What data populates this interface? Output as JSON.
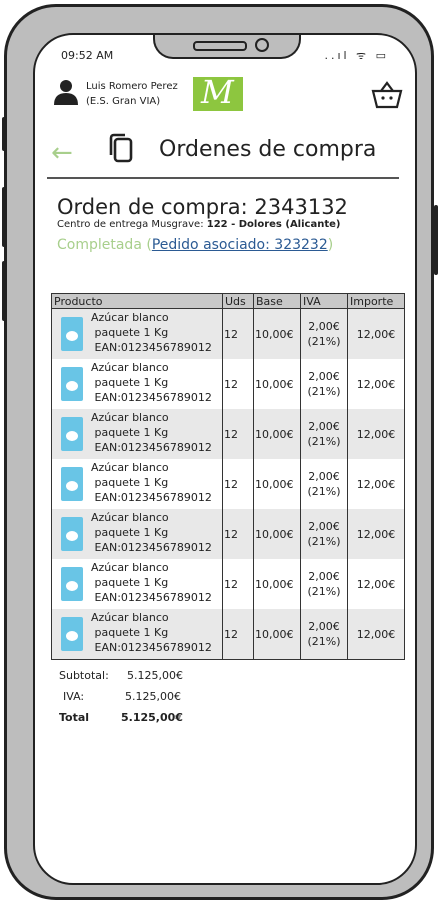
{
  "status_bar": {
    "time": "09:52 AM",
    "icons": "..ıl ᯤ ▭"
  },
  "user": {
    "name": "Luis Romero Perez",
    "station": "(E.S. Gran VIA)"
  },
  "header": {
    "title": "Ordenes de compra"
  },
  "order": {
    "title": "Orden de compra: 2343132",
    "center_label": "Centro de entrega Musgrave:",
    "center_value": "122 - Dolores (Alicante)",
    "status": "Completada",
    "linked_order": "Pedido asociado: 323232",
    "paren_open": "(",
    "paren_close": ")"
  },
  "table": {
    "headers": [
      "Producto",
      "Uds",
      "Base",
      "IVA",
      "Importe"
    ],
    "rows": [
      {
        "product": "Azúcar blanco\n paquete 1 Kg\n EAN:0123456789012",
        "uds": "12",
        "base": "10,00€",
        "iva": "2,00€\n(21%)",
        "importe": "12,00€"
      },
      {
        "product": "Azúcar blanco\n paquete 1 Kg\n EAN:0123456789012",
        "uds": "12",
        "base": "10,00€",
        "iva": "2,00€\n(21%)",
        "importe": "12,00€"
      },
      {
        "product": "Azúcar blanco\n paquete 1 Kg\n EAN:0123456789012",
        "uds": "12",
        "base": "10,00€",
        "iva": "2,00€\n(21%)",
        "importe": "12,00€"
      },
      {
        "product": "Azúcar blanco\n paquete 1 Kg\n EAN:0123456789012",
        "uds": "12",
        "base": "10,00€",
        "iva": "2,00€\n(21%)",
        "importe": "12,00€"
      },
      {
        "product": "Azúcar blanco\n paquete 1 Kg\n EAN:0123456789012",
        "uds": "12",
        "base": "10,00€",
        "iva": "2,00€\n(21%)",
        "importe": "12,00€"
      },
      {
        "product": "Azúcar blanco\n paquete 1 Kg\n EAN:0123456789012",
        "uds": "12",
        "base": "10,00€",
        "iva": "2,00€\n(21%)",
        "importe": "12,00€"
      },
      {
        "product": "Azúcar blanco\n paquete 1 Kg\n EAN:0123456789012",
        "uds": "12",
        "base": "10,00€",
        "iva": "2,00€\n(21%)",
        "importe": "12,00€"
      }
    ]
  },
  "totals": {
    "subtotal_label": "Subtotal:",
    "subtotal_value": "5.125,00€",
    "iva_label": "IVA:",
    "iva_value": "5.125,00€",
    "total_label": "Total",
    "total_value": "5.125,00€"
  },
  "colors": {
    "accent_green": "#a8cf8c",
    "link_blue": "#2b5a93",
    "logo_green": "#8dc63f"
  },
  "icons": [
    "user-icon",
    "logo",
    "cart-icon",
    "back-arrow-icon",
    "copy-icon",
    "product-image"
  ]
}
